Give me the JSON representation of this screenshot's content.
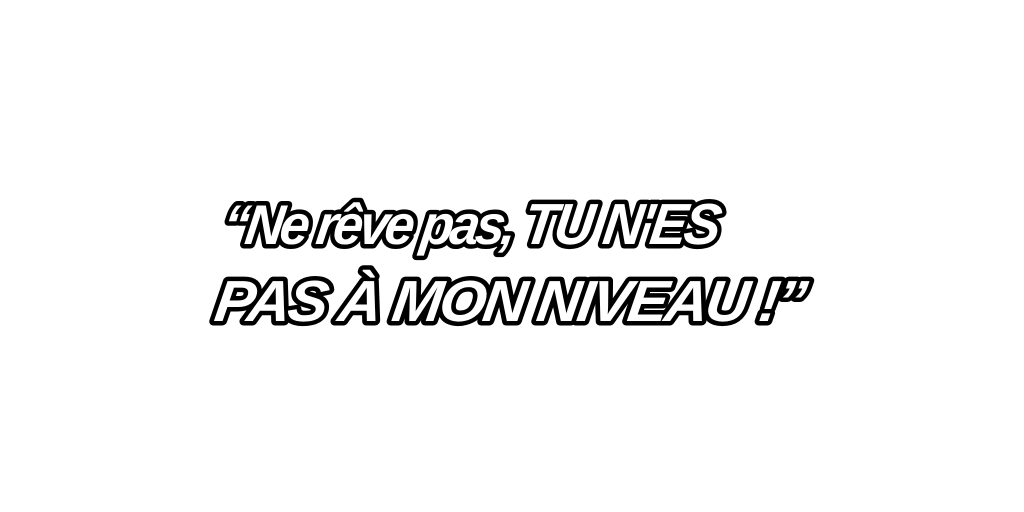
{
  "quote": {
    "line1_part1": "“Ne rêve pas, ",
    "line1_part2": "TU N'ES",
    "line2": "PAS À MON NIVEAU !”"
  }
}
